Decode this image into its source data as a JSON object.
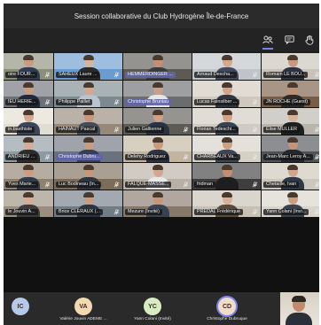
{
  "window": {
    "title": "Session collaborative du Club Hydrogène Île-de-France"
  },
  "controls": [
    {
      "icon": "participants-icon",
      "active": true
    },
    {
      "icon": "chat-icon",
      "active": false
    },
    {
      "icon": "raise-hand-icon",
      "active": false
    }
  ],
  "participants": [
    {
      "name": "oire FOUR...",
      "bg": "#8a8f7a",
      "skin": "#c99b80",
      "shirt": "#2f3c52",
      "mic": true
    },
    {
      "name": "SAHEUX Laure ...",
      "bg": "#6a9ccf",
      "skin": "#d9b39c",
      "shirt": "#2a2a2a",
      "mic": true
    },
    {
      "name": "HEMMERDINGER ...",
      "bg": "#5d5a55",
      "skin": "#c78e74",
      "shirt": "#3b3b3b",
      "mic": false,
      "highlight": true
    },
    {
      "name": "Arnaud Descha...",
      "bg": "#bfc4c8",
      "skin": "#d5a88c",
      "shirt": "#404a5e",
      "mic": true
    },
    {
      "name": "Romain LE BOU...",
      "bg": "#c8c2b8",
      "skin": "#c9997f",
      "shirt": "#2c3442",
      "mic": true
    },
    {
      "name": "IEU HERIE...",
      "bg": "#6d7078",
      "skin": "#c89c83",
      "shirt": "#1f2a3c",
      "mic": true
    },
    {
      "name": "Philippe Paillet",
      "bg": "#7b8a8f",
      "skin": "#d4a88e",
      "shirt": "#b9c4cf",
      "mic": true
    },
    {
      "name": "Christophe Bruniau",
      "bg": "#6a6c6e",
      "skin": "#caa08a",
      "shirt": "#e5e5e5",
      "mic": false,
      "highlight": true
    },
    {
      "name": "Lucas Fainsilber ...",
      "bg": "#cfc8bc",
      "skin": "#d2a588",
      "shirt": "#2f3640",
      "mic": true
    },
    {
      "name": "JN ROCHE (Guest)",
      "bg": "#7a5d44",
      "skin": "#c08f72",
      "shirt": "#2a2a2a",
      "mic": false
    },
    {
      "name": "in.basthiste",
      "bg": "#e2ddd2",
      "skin": "#d3a790",
      "shirt": "#3b4658",
      "mic": false
    },
    {
      "name": "HAINAUT Pascal",
      "bg": "#96887a",
      "skin": "#c8987c",
      "shirt": "#444b55",
      "mic": true
    },
    {
      "name": "Julien Gallienne",
      "bg": "#5e5b57",
      "skin": "#cf9f86",
      "shirt": "#2a3240",
      "mic": true
    },
    {
      "name": "Florian Tedeschi...",
      "bg": "#d0cbc2",
      "skin": "#d1a48a",
      "shirt": "#3a4352",
      "mic": true
    },
    {
      "name": "Elise MULLER",
      "bg": "#b9b5ad",
      "skin": "#d8b29c",
      "shirt": "#1f1f1f",
      "mic": true
    },
    {
      "name": "ANDRIEU ...",
      "bg": "#8e9aa3",
      "skin": "#d4ab93",
      "shirt": "#2d2d2d",
      "mic": true
    },
    {
      "name": "Christophe Dubru...",
      "bg": "#6a7280",
      "skin": "#c89b82",
      "shirt": "#38404e",
      "mic": false,
      "highlight": true
    },
    {
      "name": "Delehy Rodriguez",
      "bg": "#c2b59f",
      "skin": "#c99a7d",
      "shirt": "#2c3444",
      "mic": true
    },
    {
      "name": "CHARBEAUX Va...",
      "bg": "#d6d1c6",
      "skin": "#caa088",
      "shirt": "#3e4656",
      "mic": true
    },
    {
      "name": "Jean-Marc Leroy A...",
      "bg": "#4f5258",
      "skin": "#c4937a",
      "shirt": "#23272e",
      "mic": true
    },
    {
      "name": "Yves Marie...",
      "bg": "#8f8170",
      "skin": "#cc9d83",
      "shirt": "#333a45",
      "mic": true
    },
    {
      "name": "Luc Bodineau (In...",
      "bg": "#7d6c5a",
      "skin": "#c7977c",
      "shirt": "#2e3440",
      "mic": true
    },
    {
      "name": "FALQUE-MASSE...",
      "bg": "#b8b0a4",
      "skin": "#d2a78f",
      "shirt": "#e8e8e8",
      "mic": true
    },
    {
      "name": "fridman",
      "bg": "#3e3e3e",
      "skin": "#c28f73",
      "shirt": "#1e1e1e",
      "mic": true
    },
    {
      "name": "Chetaille, Ivan",
      "bg": "#cdc6bb",
      "skin": "#d1a68c",
      "shirt": "#2f3846",
      "mic": true
    },
    {
      "name": "le Jouvin A...",
      "bg": "#9a8f7e",
      "skin": "#d6ad96",
      "shirt": "#3c3c3c",
      "mic": false
    },
    {
      "name": "Brice CLERAUX (...",
      "bg": "#707c86",
      "skin": "#c99c82",
      "shirt": "#2a3342",
      "mic": true
    },
    {
      "name": "Mezure (Invité)",
      "bg": "#87796a",
      "skin": "#c6957a",
      "shirt": "#384252",
      "mic": false
    },
    {
      "name": "PREDAL Frédérique",
      "bg": "#c8c0b3",
      "skin": "#d8b09a",
      "shirt": "#5a4a3e",
      "mic": true
    },
    {
      "name": "Yann Colani (Invi...",
      "bg": "#d9d4ca",
      "skin": "#cb9e84",
      "shirt": "#3a4250",
      "mic": true
    }
  ],
  "bottom_row": [
    {
      "initials": "IC",
      "name": "",
      "color": "#b7c9e8"
    },
    {
      "initials": "VA",
      "name": "Valérie Jouvin ADEME ...",
      "color": "#f3d9b1"
    },
    {
      "initials": "YC",
      "name": "Yann Colani (Invité)",
      "color": "#d8ecc4"
    },
    {
      "initials": "CD",
      "name": "Christophe Dubruque",
      "color": "#f0dcc8"
    }
  ]
}
